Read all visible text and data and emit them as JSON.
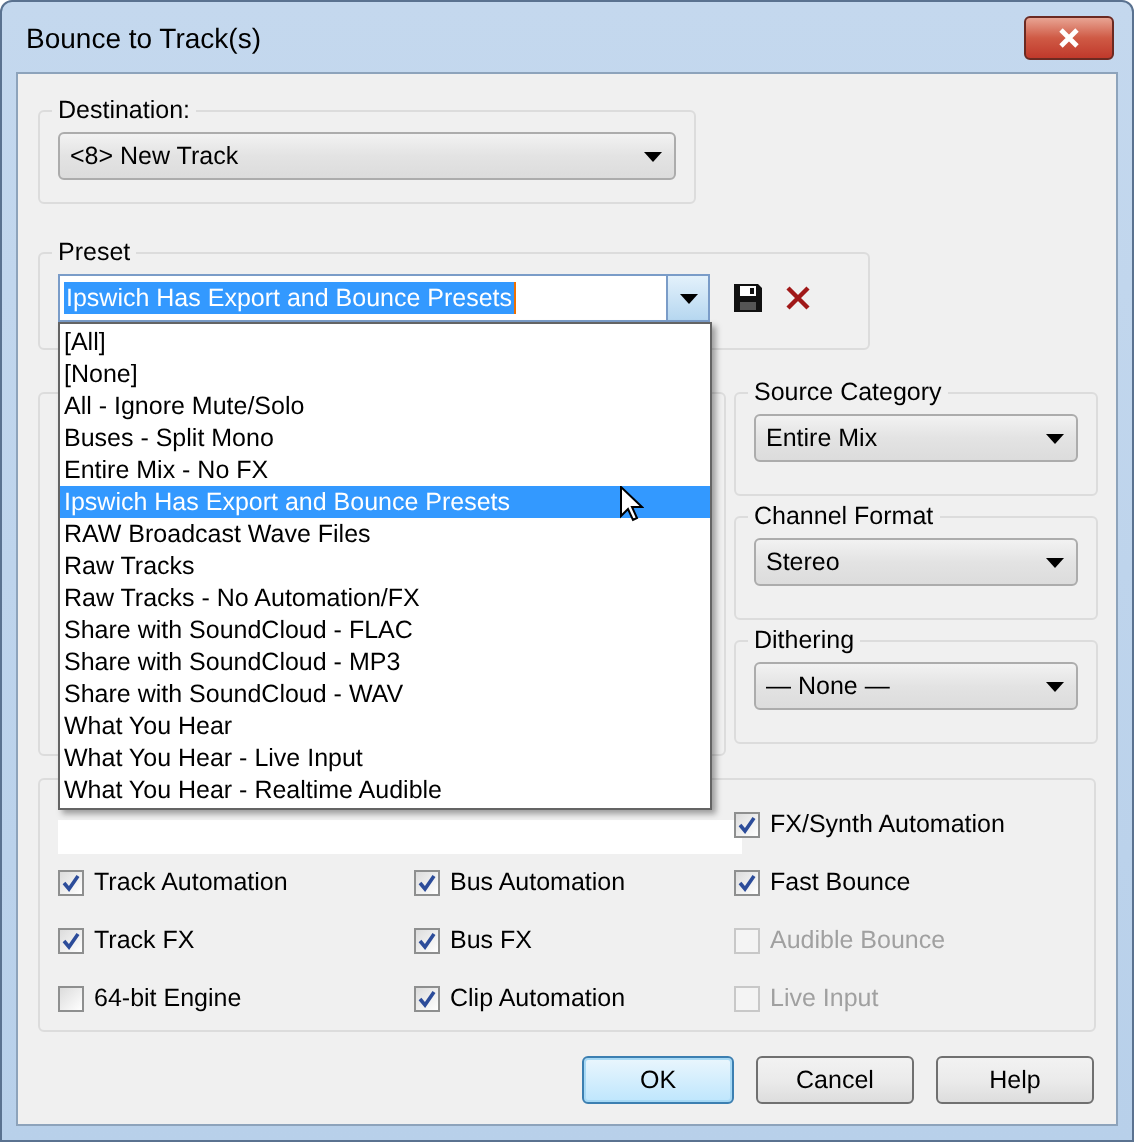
{
  "window": {
    "title": "Bounce to Track(s)"
  },
  "destination": {
    "label": "Destination:",
    "value": "<8> New Track"
  },
  "preset": {
    "label": "Preset",
    "value": "Ipswich Has Export and Bounce Presets",
    "text_selected": true
  },
  "preset_list": {
    "open": true,
    "items": [
      {
        "label": "[All]",
        "selected": false
      },
      {
        "label": "[None]",
        "selected": false
      },
      {
        "label": "All - Ignore Mute/Solo",
        "selected": false
      },
      {
        "label": "Buses - Split Mono",
        "selected": false
      },
      {
        "label": "Entire Mix - No FX",
        "selected": false
      },
      {
        "label": "Ipswich Has Export and Bounce Presets",
        "selected": true
      },
      {
        "label": "RAW Broadcast Wave Files",
        "selected": false
      },
      {
        "label": "Raw Tracks",
        "selected": false
      },
      {
        "label": "Raw Tracks - No Automation/FX",
        "selected": false
      },
      {
        "label": "Share with SoundCloud - FLAC",
        "selected": false
      },
      {
        "label": "Share with SoundCloud - MP3",
        "selected": false
      },
      {
        "label": "Share with SoundCloud - WAV",
        "selected": false
      },
      {
        "label": "What You Hear",
        "selected": false
      },
      {
        "label": "What You Hear - Live Input",
        "selected": false
      },
      {
        "label": "What You Hear - Realtime Audible",
        "selected": false
      }
    ]
  },
  "source_category": {
    "label": "Source Category",
    "value": "Entire Mix"
  },
  "channel_format": {
    "label": "Channel Format",
    "value": "Stereo"
  },
  "dithering": {
    "label": "Dithering",
    "value": "— None —"
  },
  "options": [
    {
      "label": "FX/Synth Automation",
      "checked": true,
      "disabled": false
    },
    {
      "label": "Track Automation",
      "checked": true,
      "disabled": false
    },
    {
      "label": "Bus Automation",
      "checked": true,
      "disabled": false
    },
    {
      "label": "Fast Bounce",
      "checked": true,
      "disabled": false
    },
    {
      "label": "Track FX",
      "checked": true,
      "disabled": false
    },
    {
      "label": "Bus FX",
      "checked": true,
      "disabled": false
    },
    {
      "label": "Audible Bounce",
      "checked": false,
      "disabled": true
    },
    {
      "label": "64-bit Engine",
      "checked": false,
      "disabled": false
    },
    {
      "label": "Clip Automation",
      "checked": true,
      "disabled": false
    },
    {
      "label": "Live Input",
      "checked": false,
      "disabled": true
    }
  ],
  "buttons": [
    {
      "label": "OK",
      "default": true
    },
    {
      "label": "Cancel",
      "default": false
    },
    {
      "label": "Help",
      "default": false
    }
  ]
}
